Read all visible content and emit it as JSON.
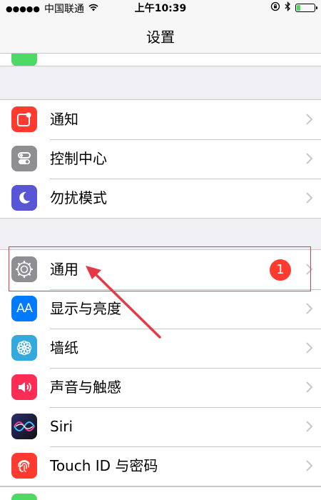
{
  "status_bar": {
    "carrier": "中国联通",
    "time": "上午10:39",
    "signal_icon": "signal-dots-icon",
    "wifi_icon": "wifi-icon",
    "battery_level": 0.2
  },
  "nav": {
    "title": "设置"
  },
  "groups": [
    {
      "items": [
        {
          "label": "通知",
          "icon": "notification-icon",
          "color": "#ff3b30"
        },
        {
          "label": "控制中心",
          "icon": "control-center-icon",
          "color": "#8e8e93"
        },
        {
          "label": "勿扰模式",
          "icon": "moon-icon",
          "color": "#5856d6"
        }
      ]
    },
    {
      "items": [
        {
          "label": "通用",
          "icon": "gear-icon",
          "color": "#8e8e93",
          "badge": "1"
        },
        {
          "label": "显示与亮度",
          "icon": "display-icon",
          "color": "#007aff",
          "icon_text": "AA"
        },
        {
          "label": "墙纸",
          "icon": "wallpaper-icon",
          "color": "#34aadc"
        },
        {
          "label": "声音与触感",
          "icon": "sound-icon",
          "color": "#ff2d55"
        },
        {
          "label": "Siri",
          "icon": "siri-icon",
          "color": "#1a1a2e"
        },
        {
          "label": "Touch ID 与密码",
          "icon": "fingerprint-icon",
          "color": "#ff3b30"
        }
      ]
    }
  ],
  "colors": {
    "annotation": "#e63946"
  }
}
